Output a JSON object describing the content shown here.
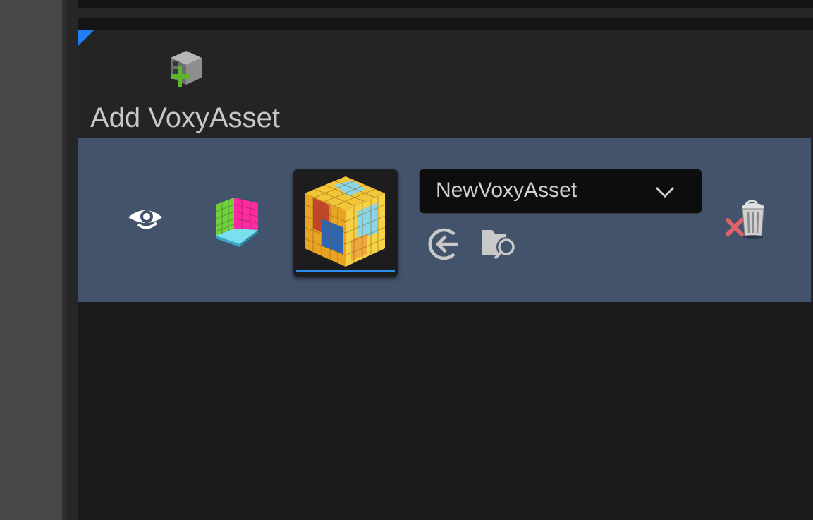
{
  "panel": {
    "add_label": "Add VoxyAsset",
    "add_icon": "voxel-cube-plus-icon",
    "accent_color": "#1e7ff2"
  },
  "asset_row": {
    "background_color": "#43536b",
    "visibility_icon": "eye-icon",
    "type_icon": "voxel-room-icon",
    "thumbnail_icon": "voxel-asset-cube-thumbnail",
    "asset_combo": {
      "selected_value": "NewVoxyAsset",
      "icon": "chevron-down-icon"
    },
    "use_selected_icon": "arrow-left-circle-icon",
    "browse_icon": "folder-search-icon",
    "delete_icon": "trash-x-icon"
  }
}
